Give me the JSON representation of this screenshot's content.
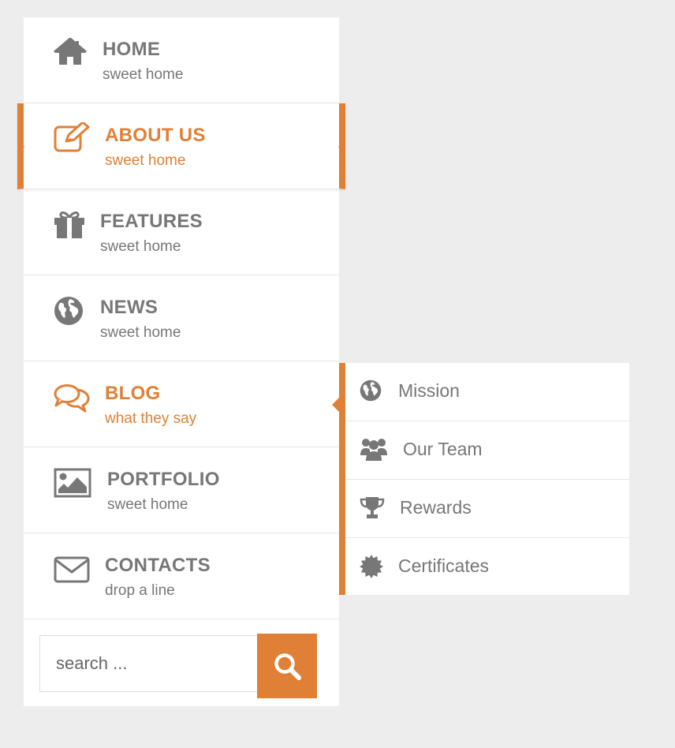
{
  "accent_color": "#e08036",
  "text_color": "#777777",
  "menu": {
    "items": [
      {
        "title": "HOME",
        "subtitle": "sweet home",
        "icon": "home-icon"
      },
      {
        "title": "ABOUT US",
        "subtitle": "sweet home",
        "icon": "edit-icon"
      },
      {
        "title": "FEATURES",
        "subtitle": "sweet home",
        "icon": "gift-icon"
      },
      {
        "title": "NEWS",
        "subtitle": "sweet home",
        "icon": "globe-icon"
      },
      {
        "title": "BLOG",
        "subtitle": "what they say",
        "icon": "comments-icon"
      },
      {
        "title": "PORTFOLIO",
        "subtitle": "sweet home",
        "icon": "image-icon"
      },
      {
        "title": "CONTACTS",
        "subtitle": "drop a line",
        "icon": "envelope-icon"
      }
    ]
  },
  "search": {
    "placeholder": "search ...",
    "button_icon": "search-icon"
  },
  "submenu": {
    "items": [
      {
        "label": "Mission",
        "icon": "globe-icon"
      },
      {
        "label": "Our Team",
        "icon": "users-icon"
      },
      {
        "label": "Rewards",
        "icon": "trophy-icon"
      },
      {
        "label": "Certificates",
        "icon": "certificate-icon"
      }
    ]
  }
}
